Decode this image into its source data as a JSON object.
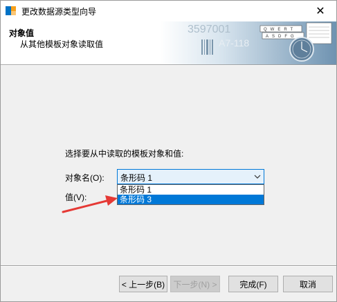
{
  "window": {
    "title": "更改数据源类型向导",
    "close_glyph": "✕"
  },
  "header": {
    "title": "对象值",
    "subtitle": "从其他模板对象读取值",
    "art_text_1": "3597001",
    "art_text_2": "A7-118",
    "art_keys_1": "QWERT",
    "art_keys_2": "ASDFG"
  },
  "form": {
    "prompt": "选择要从中读取的模板对象和值:",
    "object_label": "对象名(O):",
    "value_label": "值(V):",
    "object_select": {
      "selected": "条形码 1",
      "options": [
        "条形码 1",
        "条形码 3"
      ],
      "highlighted_index": 1
    }
  },
  "buttons": {
    "back": "< 上一步(B)",
    "next": "下一步(N) >",
    "finish": "完成(F)",
    "cancel": "取消"
  },
  "colors": {
    "accent": "#0078d7",
    "annotation_arrow": "#e53935"
  }
}
